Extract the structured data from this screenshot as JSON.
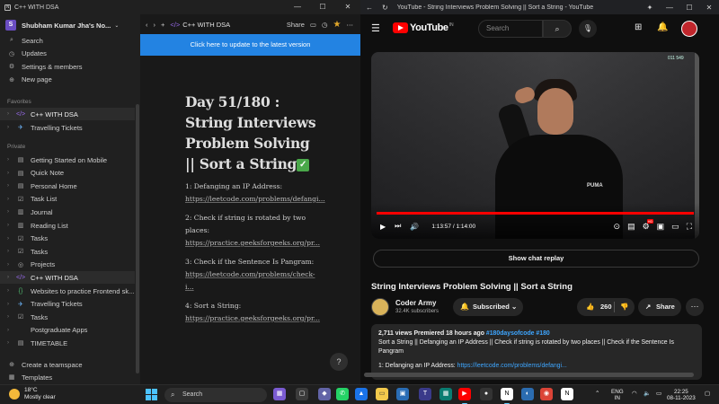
{
  "notion": {
    "window_title": "C++ WITH DSA",
    "workspace": {
      "initial": "S",
      "name": "Shubham Kumar Jha's No..."
    },
    "top_menu": [
      {
        "icon": "search-icon",
        "glyph": "⌕",
        "label": "Search"
      },
      {
        "icon": "clock-icon",
        "glyph": "◷",
        "label": "Updates"
      },
      {
        "icon": "gear-icon",
        "glyph": "⚙",
        "label": "Settings & members"
      },
      {
        "icon": "plus-circle-icon",
        "glyph": "⊕",
        "label": "New page"
      }
    ],
    "favorites_label": "Favorites",
    "favorites": [
      {
        "icon": "code-icon",
        "glyph": "</>",
        "label": "C++ WITH DSA",
        "active": true
      },
      {
        "icon": "plane-icon",
        "glyph": "✈",
        "label": "Travelling Tickets",
        "active": false
      }
    ],
    "private_label": "Private",
    "private": [
      {
        "icon": "page-icon",
        "glyph": "▤",
        "label": "Getting Started on Mobile",
        "active": false
      },
      {
        "icon": "page-icon",
        "glyph": "▤",
        "label": "Quick Note",
        "active": false
      },
      {
        "icon": "person-icon",
        "glyph": "▤",
        "label": "Personal Home",
        "active": false
      },
      {
        "icon": "checklist-icon",
        "glyph": "☑",
        "label": "Task List",
        "active": false
      },
      {
        "icon": "book-icon",
        "glyph": "▥",
        "label": "Journal",
        "active": false
      },
      {
        "icon": "book-icon",
        "glyph": "▥",
        "label": "Reading List",
        "active": false
      },
      {
        "icon": "checkbox-icon",
        "glyph": "☑",
        "label": "Tasks",
        "active": false
      },
      {
        "icon": "checkbox-icon",
        "glyph": "☑",
        "label": "Tasks",
        "active": false
      },
      {
        "icon": "target-icon",
        "glyph": "◎",
        "label": "Projects",
        "active": false
      },
      {
        "icon": "code-icon",
        "glyph": "</>",
        "label": "C++ WITH DSA",
        "active": true
      },
      {
        "icon": "braces-icon",
        "glyph": "{}",
        "label": "Websites to practice Frontend sk...",
        "active": false
      },
      {
        "icon": "plane-icon",
        "glyph": "✈",
        "label": "Travelling Tickets",
        "active": false
      },
      {
        "icon": "checkbox-icon",
        "glyph": "☑",
        "label": "Tasks",
        "active": false
      },
      {
        "icon": "",
        "glyph": "",
        "label": "Postgraduate Apps",
        "active": false
      },
      {
        "icon": "page-icon",
        "glyph": "▤",
        "label": "TIMETABLE",
        "active": false
      }
    ],
    "bottom_menu": [
      {
        "icon": "team-icon",
        "glyph": "⊕",
        "label": "Create a teamspace"
      },
      {
        "icon": "template-icon",
        "glyph": "▦",
        "label": "Templates"
      }
    ],
    "breadcrumb": "C++ WITH DSA",
    "share_label": "Share",
    "update_banner": "Click here to update to the latest version",
    "page_title": "Day 51/180 : String Interviews Problem Solving || Sort a String",
    "items": [
      {
        "label": "1: Defanging an IP Address:",
        "link": "https://leetcode.com/problems/defangi..."
      },
      {
        "label": "2: Check if string is rotated by two places:",
        "link": "https://practice.geeksforgeeks.org/pr..."
      },
      {
        "label": "3: Check if the Sentence Is Pangram:",
        "link": "https://leetcode.com/problems/check-i..."
      },
      {
        "label": "4: Sort a String:",
        "link": "https://practice.geeksforgeeks.org/pr..."
      }
    ],
    "help": "?"
  },
  "youtube": {
    "window_title": "YouTube - String Interviews Problem Solving || Sort a String - YouTube",
    "logo_text": "YouTube",
    "country": "IN",
    "search_placeholder": "Search",
    "video": {
      "overlay_tag": "011 549",
      "current_time": "1:13:57",
      "duration": "1:14:00",
      "progress_fraction": 0.9993,
      "brand": "PUMA"
    },
    "chat_replay_label": "Show chat replay",
    "title": "String Interviews Problem Solving || Sort a String",
    "channel": {
      "name": "Coder Army",
      "subscribers": "32.4K subscribers"
    },
    "subscribed_label": "Subscribed",
    "likes": "260",
    "share_label": "Share",
    "description": {
      "meta": "2,711 views  Premiered 18 hours ago",
      "hashtags": "#180daysofcode #180",
      "text": "Sort a String || Defanging an IP Address || Check if string is rotated by two places || Check if the Sentence Is Pangram",
      "line_label": "1: Defanging an IP Address:",
      "line_link": "https://leetcode.com/problems/defangi..."
    }
  },
  "taskbar": {
    "temperature": "18°C",
    "weather": "Mostly clear",
    "search_label": "Search",
    "language": "ENG",
    "region": "IN",
    "time": "22:25",
    "date": "08-11-2023",
    "badges": {
      "app1": "1",
      "whatsapp": "1",
      "teams": "63"
    }
  },
  "colors": {
    "notion_accent": "#2383e2",
    "youtube_red": "#ff0000",
    "link_blue": "#3ea6ff",
    "windows_accent": "#4cc2ff"
  }
}
